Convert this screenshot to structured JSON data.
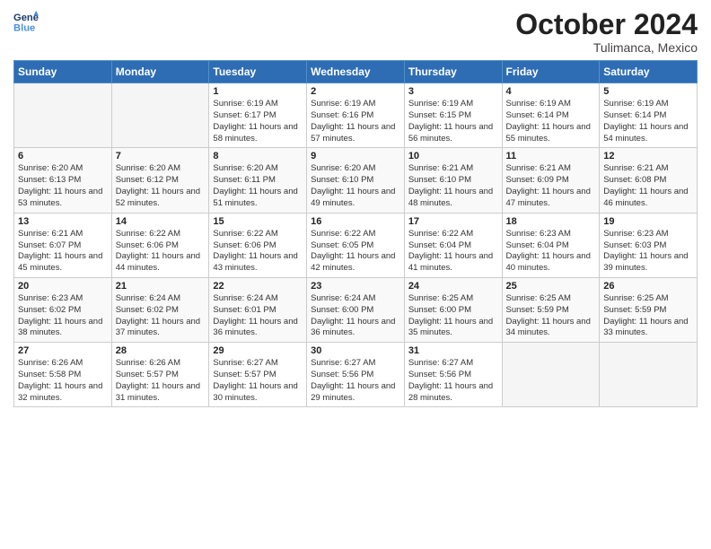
{
  "header": {
    "logo_line1": "General",
    "logo_line2": "Blue",
    "month": "October 2024",
    "location": "Tulimanca, Mexico"
  },
  "weekdays": [
    "Sunday",
    "Monday",
    "Tuesday",
    "Wednesday",
    "Thursday",
    "Friday",
    "Saturday"
  ],
  "weeks": [
    [
      {
        "day": "",
        "info": ""
      },
      {
        "day": "",
        "info": ""
      },
      {
        "day": "1",
        "info": "Sunrise: 6:19 AM\nSunset: 6:17 PM\nDaylight: 11 hours and 58 minutes."
      },
      {
        "day": "2",
        "info": "Sunrise: 6:19 AM\nSunset: 6:16 PM\nDaylight: 11 hours and 57 minutes."
      },
      {
        "day": "3",
        "info": "Sunrise: 6:19 AM\nSunset: 6:15 PM\nDaylight: 11 hours and 56 minutes."
      },
      {
        "day": "4",
        "info": "Sunrise: 6:19 AM\nSunset: 6:14 PM\nDaylight: 11 hours and 55 minutes."
      },
      {
        "day": "5",
        "info": "Sunrise: 6:19 AM\nSunset: 6:14 PM\nDaylight: 11 hours and 54 minutes."
      }
    ],
    [
      {
        "day": "6",
        "info": "Sunrise: 6:20 AM\nSunset: 6:13 PM\nDaylight: 11 hours and 53 minutes."
      },
      {
        "day": "7",
        "info": "Sunrise: 6:20 AM\nSunset: 6:12 PM\nDaylight: 11 hours and 52 minutes."
      },
      {
        "day": "8",
        "info": "Sunrise: 6:20 AM\nSunset: 6:11 PM\nDaylight: 11 hours and 51 minutes."
      },
      {
        "day": "9",
        "info": "Sunrise: 6:20 AM\nSunset: 6:10 PM\nDaylight: 11 hours and 49 minutes."
      },
      {
        "day": "10",
        "info": "Sunrise: 6:21 AM\nSunset: 6:10 PM\nDaylight: 11 hours and 48 minutes."
      },
      {
        "day": "11",
        "info": "Sunrise: 6:21 AM\nSunset: 6:09 PM\nDaylight: 11 hours and 47 minutes."
      },
      {
        "day": "12",
        "info": "Sunrise: 6:21 AM\nSunset: 6:08 PM\nDaylight: 11 hours and 46 minutes."
      }
    ],
    [
      {
        "day": "13",
        "info": "Sunrise: 6:21 AM\nSunset: 6:07 PM\nDaylight: 11 hours and 45 minutes."
      },
      {
        "day": "14",
        "info": "Sunrise: 6:22 AM\nSunset: 6:06 PM\nDaylight: 11 hours and 44 minutes."
      },
      {
        "day": "15",
        "info": "Sunrise: 6:22 AM\nSunset: 6:06 PM\nDaylight: 11 hours and 43 minutes."
      },
      {
        "day": "16",
        "info": "Sunrise: 6:22 AM\nSunset: 6:05 PM\nDaylight: 11 hours and 42 minutes."
      },
      {
        "day": "17",
        "info": "Sunrise: 6:22 AM\nSunset: 6:04 PM\nDaylight: 11 hours and 41 minutes."
      },
      {
        "day": "18",
        "info": "Sunrise: 6:23 AM\nSunset: 6:04 PM\nDaylight: 11 hours and 40 minutes."
      },
      {
        "day": "19",
        "info": "Sunrise: 6:23 AM\nSunset: 6:03 PM\nDaylight: 11 hours and 39 minutes."
      }
    ],
    [
      {
        "day": "20",
        "info": "Sunrise: 6:23 AM\nSunset: 6:02 PM\nDaylight: 11 hours and 38 minutes."
      },
      {
        "day": "21",
        "info": "Sunrise: 6:24 AM\nSunset: 6:02 PM\nDaylight: 11 hours and 37 minutes."
      },
      {
        "day": "22",
        "info": "Sunrise: 6:24 AM\nSunset: 6:01 PM\nDaylight: 11 hours and 36 minutes."
      },
      {
        "day": "23",
        "info": "Sunrise: 6:24 AM\nSunset: 6:00 PM\nDaylight: 11 hours and 36 minutes."
      },
      {
        "day": "24",
        "info": "Sunrise: 6:25 AM\nSunset: 6:00 PM\nDaylight: 11 hours and 35 minutes."
      },
      {
        "day": "25",
        "info": "Sunrise: 6:25 AM\nSunset: 5:59 PM\nDaylight: 11 hours and 34 minutes."
      },
      {
        "day": "26",
        "info": "Sunrise: 6:25 AM\nSunset: 5:59 PM\nDaylight: 11 hours and 33 minutes."
      }
    ],
    [
      {
        "day": "27",
        "info": "Sunrise: 6:26 AM\nSunset: 5:58 PM\nDaylight: 11 hours and 32 minutes."
      },
      {
        "day": "28",
        "info": "Sunrise: 6:26 AM\nSunset: 5:57 PM\nDaylight: 11 hours and 31 minutes."
      },
      {
        "day": "29",
        "info": "Sunrise: 6:27 AM\nSunset: 5:57 PM\nDaylight: 11 hours and 30 minutes."
      },
      {
        "day": "30",
        "info": "Sunrise: 6:27 AM\nSunset: 5:56 PM\nDaylight: 11 hours and 29 minutes."
      },
      {
        "day": "31",
        "info": "Sunrise: 6:27 AM\nSunset: 5:56 PM\nDaylight: 11 hours and 28 minutes."
      },
      {
        "day": "",
        "info": ""
      },
      {
        "day": "",
        "info": ""
      }
    ]
  ]
}
